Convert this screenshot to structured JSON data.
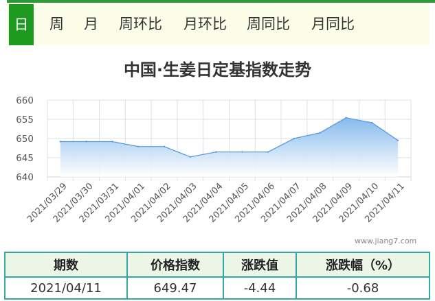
{
  "tabs": [
    {
      "label": "日",
      "active": true
    },
    {
      "label": "周",
      "active": false
    },
    {
      "label": "月",
      "active": false
    },
    {
      "label": "周环比",
      "active": false
    },
    {
      "label": "月环比",
      "active": false
    },
    {
      "label": "周同比",
      "active": false
    },
    {
      "label": "月同比",
      "active": false
    }
  ],
  "colors": {
    "accent": "#1e9a21",
    "area": "#7fb6ec",
    "line": "#5a9ae0",
    "table_border": "#35a7a7"
  },
  "chart_data": {
    "type": "area",
    "title": "中国·生姜日定基指数走势",
    "categories": [
      "2021/03/29",
      "2021/03/30",
      "2021/03/31",
      "2021/04/01",
      "2021/04/02",
      "2021/04/03",
      "2021/04/04",
      "2021/04/05",
      "2021/04/06",
      "2021/04/07",
      "2021/04/08",
      "2021/04/09",
      "2021/04/10",
      "2021/04/11"
    ],
    "series": [
      {
        "values": [
          649.2,
          649.2,
          649.2,
          647.9,
          647.9,
          645.2,
          646.5,
          646.5,
          646.5,
          650.0,
          651.5,
          655.4,
          654.1,
          649.5
        ]
      }
    ],
    "ylim": [
      640,
      660
    ],
    "yticks": [
      640,
      645,
      650,
      655,
      660
    ],
    "grid": true,
    "xlabel": "",
    "ylabel": ""
  },
  "watermark": "www.jiang7.com",
  "table": {
    "headers": [
      "期数",
      "价格指数",
      "涨跌值",
      "涨跌幅（%）"
    ],
    "row": [
      "2021/04/11",
      "649.47",
      "-4.44",
      "-0.68"
    ]
  }
}
